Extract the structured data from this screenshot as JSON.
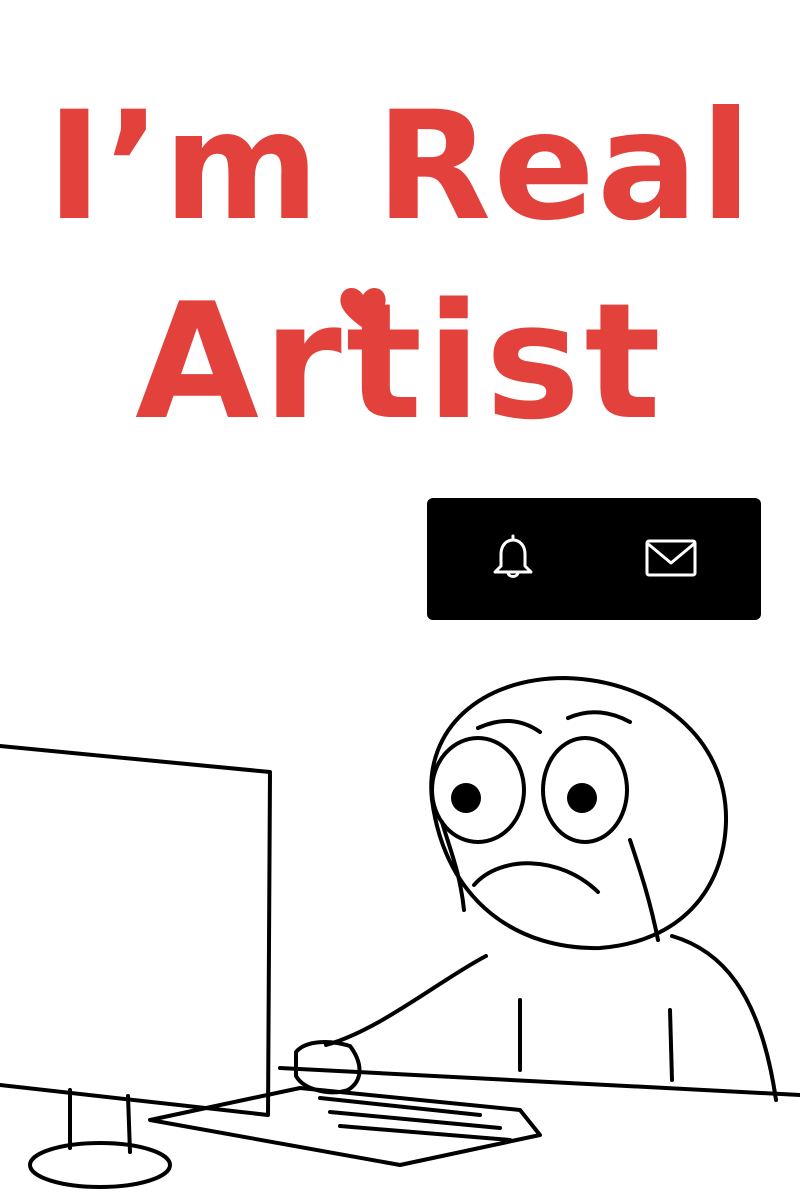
{
  "title": {
    "line1": "I’m Real",
    "line2": "Artist"
  },
  "notification_bar": {
    "icons": [
      "bell-icon",
      "mail-icon"
    ]
  },
  "colors": {
    "title": "#e3413b",
    "heart": "#e3413b",
    "bar_background": "#000000",
    "icon_stroke": "#ffffff",
    "line_art": "#000000",
    "background": "#ffffff"
  }
}
